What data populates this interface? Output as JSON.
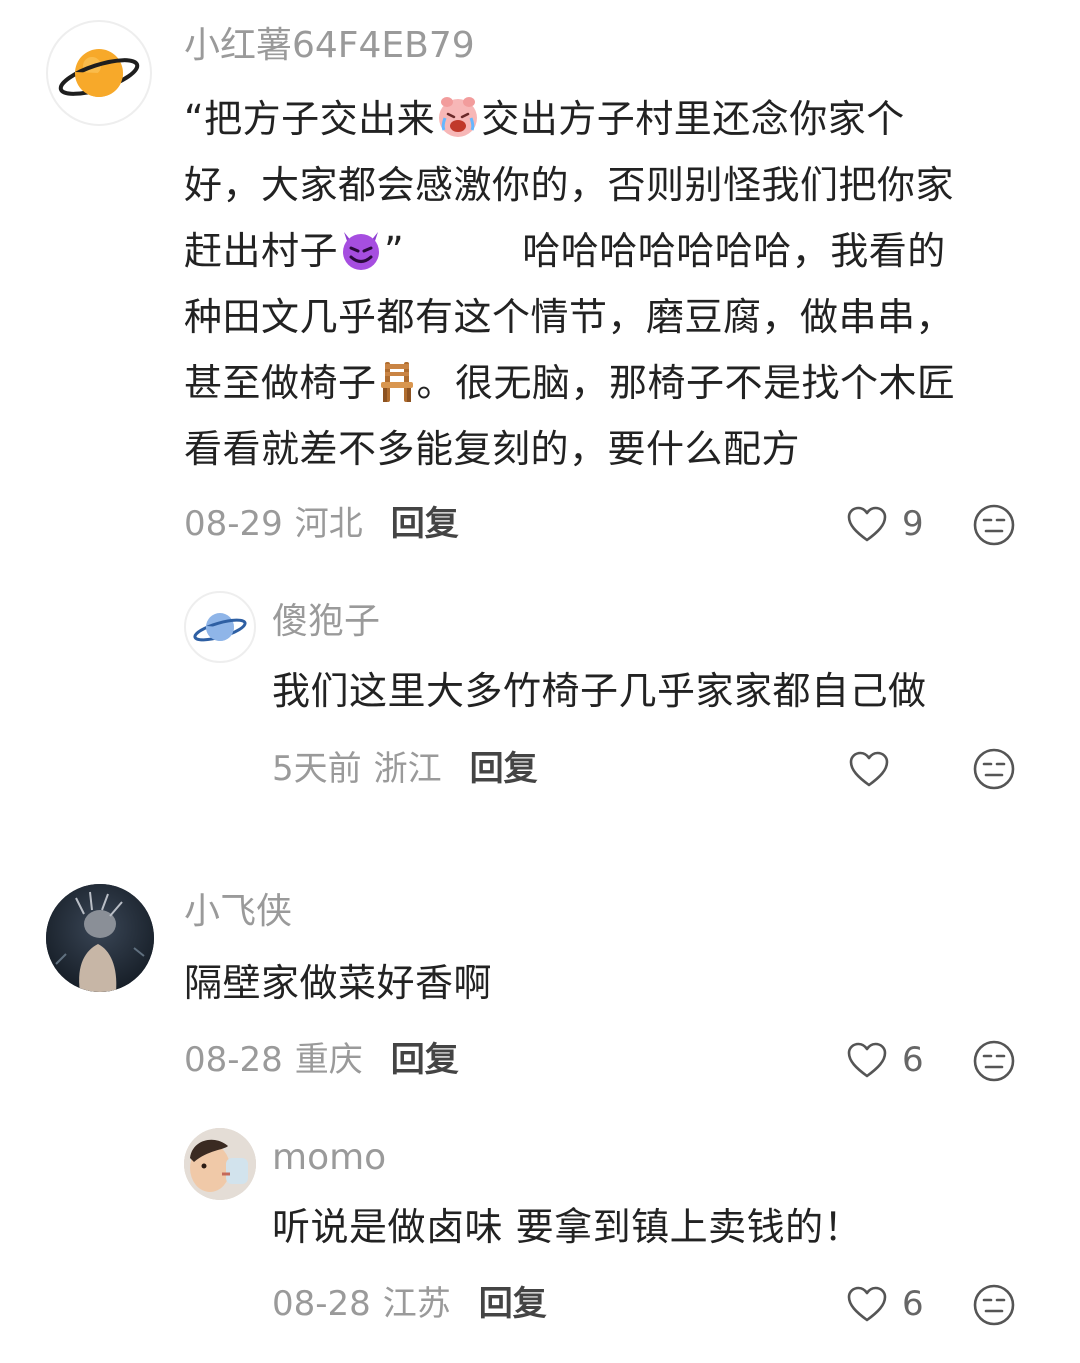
{
  "comments": [
    {
      "username": "小红薯64F4EB79",
      "lines": [
        [
          "“把方子交出来",
          "交出方子村里还念你家个"
        ],
        [
          "好，大家都会感激你的，否则别怪我们把你家"
        ],
        [
          "赶出村子",
          "”",
          "哈哈哈哈哈哈哈，我看的"
        ],
        [
          "种田文几乎都有这个情节，磨豆腐，做串串，"
        ],
        [
          "甚至做椅子",
          "。很无脑，那椅子不是找个木匠"
        ],
        [
          "看看就差不多能复刻的，要什么配方"
        ]
      ],
      "date": "08-29",
      "location": "河北",
      "reply_label": "回复",
      "likes": "9",
      "replies": [
        {
          "username": "傻狍子",
          "text": "我们这里大多竹椅子几乎家家都自己做",
          "date": "5天前",
          "location": "浙江",
          "reply_label": "回复",
          "likes": ""
        }
      ]
    },
    {
      "username": "小飞侠",
      "text": "隔壁家做菜好香啊",
      "date": "08-28",
      "location": "重庆",
      "reply_label": "回复",
      "likes": "6",
      "replies": [
        {
          "username": "momo",
          "text": "听说是做卤味 要拿到镇上卖钱的！",
          "date": "08-28",
          "location": "江苏",
          "reply_label": "回复",
          "likes": "6"
        }
      ]
    }
  ],
  "icons": {
    "like": "heart-outline-icon",
    "dislike": "neutral-face-icon",
    "emoji_1": "crying-pig-face-emoji",
    "emoji_2": "smiling-devil-emoji",
    "emoji_3": "chair-emoji"
  },
  "colors": {
    "text_primary": "#222222",
    "text_secondary": "#9a9a9a",
    "reply_label": "#444444",
    "planet_orange": "#f5a623",
    "planet_blue": "#5b8fd6"
  }
}
